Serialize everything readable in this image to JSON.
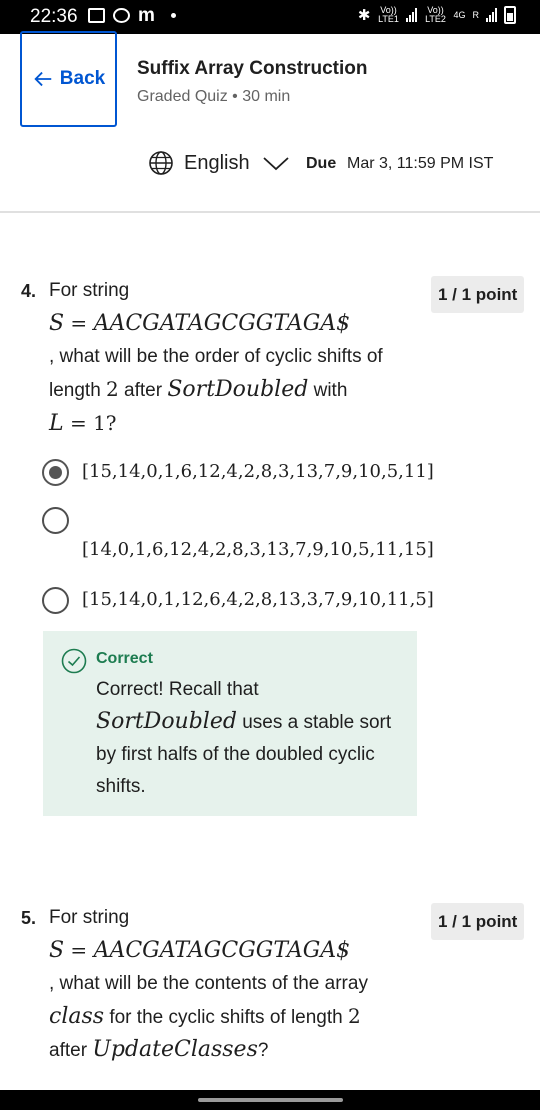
{
  "status_bar": {
    "time": "22:36",
    "notification_icons": [
      "gallery-icon",
      "whatsapp-icon",
      "m-icon"
    ],
    "m_letter": "m",
    "net1": "Vo)) LTE1",
    "net2": "Vo)) LTE2",
    "net_4g": "4G",
    "net_r": "R"
  },
  "header": {
    "back_label": "Back",
    "title": "Suffix Array Construction",
    "subtitle": "Graded Quiz • 30 min",
    "language": "English",
    "due_label": "Due",
    "due_date": "Mar 3, 11:59 PM IST"
  },
  "questions": [
    {
      "number": "4.",
      "points": "1 / 1 point",
      "intro": "For string",
      "formula_lhs": "S",
      "formula_eq": " = ",
      "formula_rhs": "AACGATAGCGGTAGA$",
      "line2": ", what will be the order of cyclic shifts of",
      "line3_pre": "length ",
      "line3_num": "2",
      "line3_mid": " after ",
      "line3_math": "SortDoubled",
      "line3_post": " with",
      "line4_var": "L",
      "line4_rest": " = 1?",
      "options": [
        {
          "text": "[15,14,0,1,6,12,4,2,8,3,13,7,9,10,5,11]",
          "selected": true
        },
        {
          "text": "[14,0,1,6,12,4,2,8,3,13,7,9,10,5,11,15]",
          "selected": false
        },
        {
          "text": "[15,14,0,1,12,6,4,2,8,13,3,7,9,10,11,5]",
          "selected": false
        }
      ],
      "feedback": {
        "title": "Correct",
        "line1": "Correct! Recall that",
        "line2_math": "SortDoubled",
        "line2_rest": " uses a stable sort",
        "line3": "by first halfs of the doubled cyclic",
        "line4": "shifts."
      }
    },
    {
      "number": "5.",
      "points": "1 / 1 point",
      "intro": "For string",
      "formula_lhs": "S",
      "formula_eq": " = ",
      "formula_rhs": "AACGATAGCGGTAGA$",
      "line2": ", what will be the contents of the array",
      "line3_math": "class",
      "line3_mid": " for the cyclic shifts of length ",
      "line3_num": "2",
      "line4_pre": "after ",
      "line4_math": "UpdateClasses",
      "line4_post": "?"
    }
  ],
  "colors": {
    "accent": "#0056d2",
    "correct_green": "#1d7c50",
    "feedback_bg": "#e6f2ec",
    "points_bg": "#ececec"
  }
}
